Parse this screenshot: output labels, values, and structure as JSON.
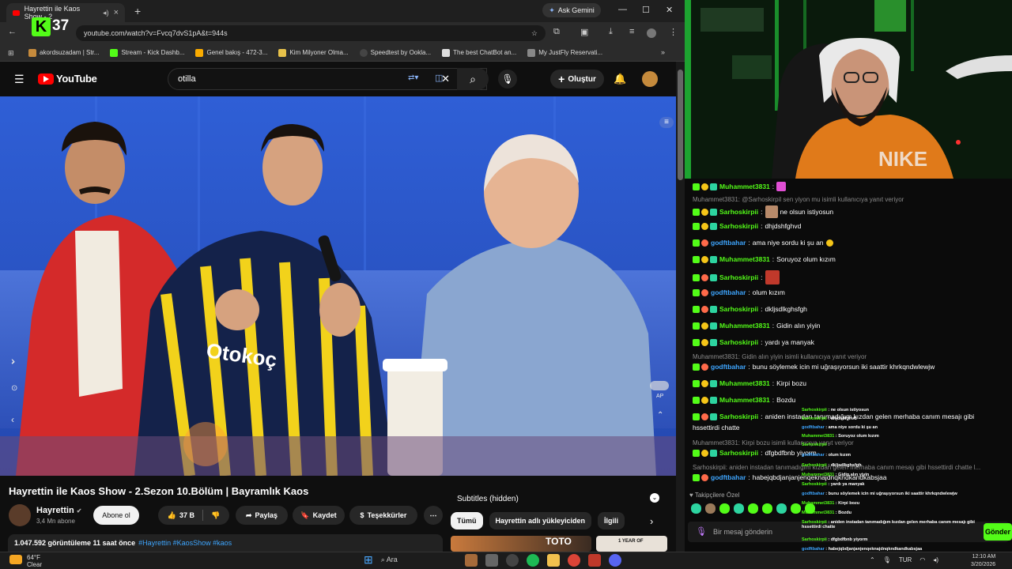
{
  "browser": {
    "tab_title": "Hayrettin ile Kaos Show - 2",
    "ask_gemini": "Ask Gemini",
    "url": "youtube.com/watch?v=Fvcq7dvS1pA&t=944s",
    "bookmarks": [
      "akordsuzadam | Str...",
      "Stream - Kick Dashb...",
      "Genel bakış - 472-3...",
      "Kim Milyoner Olma...",
      "Speedtest by Ookla...",
      "The best ChatBot an...",
      "My JustFly Reservati..."
    ],
    "colors": {
      "accent": "#53fc18",
      "youtube_red": "#ff0000",
      "link_blue": "#3ea6ff"
    }
  },
  "kick_overlay": {
    "logo": "K",
    "viewer_count": "37"
  },
  "youtube": {
    "logo_text": "YouTube",
    "search_value": "otilla",
    "create_label": "Oluştur",
    "video_title": "Hayrettin ile Kaos Show - 2.Sezon 10.Bölüm | Bayramlık Kaos",
    "channel_name": "Hayrettin",
    "subscribers": "3,4 Mn abone",
    "subscribe_label": "Abone ol",
    "likes": "37 B",
    "share_label": "Paylaş",
    "save_label": "Kaydet",
    "thanks_label": "Teşekkürler",
    "views_date": "1.047.592 görüntüleme  11 saat önce",
    "hashtags": "#Hayrettin #KaosShow #kaos",
    "subtitles": "Subtitles (hidden)",
    "chips": [
      "Tümü",
      "Hayrettin adlı yükleyiciden",
      "İlgili"
    ],
    "thumb_text": [
      "TOTO",
      "1 YEAR OF"
    ],
    "video_overlay_ap": "AP"
  },
  "taskbar": {
    "temp": "64°F",
    "weather": "Clear",
    "search": "Ara",
    "lang": "TUR",
    "time": "12:10 AM",
    "date": "3/20/2026"
  },
  "chat": {
    "messages": [
      {
        "user": "Muhammet3831",
        "text": "",
        "color": "#53fc18",
        "emote": true
      },
      {
        "reply": "Muhammet3831: @Sarhoskirpil sen yiyon mu isimli kullanıcıya yanıt veriyor"
      },
      {
        "user": "Sarhoskirpii",
        "text": "ne olsun istiyosun",
        "color": "#53fc18",
        "emote": true
      },
      {
        "user": "Sarhoskirpii",
        "text": "dhjdshfghvd",
        "color": "#53fc18"
      },
      {
        "user": "godftbahar",
        "text": "ama niye sordu ki şu an",
        "color": "#3ea6ff"
      },
      {
        "user": "Muhammet3831",
        "text": "Soruyoz olum kızım",
        "color": "#53fc18"
      },
      {
        "user": "Sarhoskirpii",
        "text": "",
        "color": "#53fc18",
        "emote": true
      },
      {
        "user": "godftbahar",
        "text": "olum kızım",
        "color": "#3ea6ff"
      },
      {
        "user": "Sarhoskirpii",
        "text": "dkljsdlkghsfgh",
        "color": "#53fc18"
      },
      {
        "user": "Muhammet3831",
        "text": "Gidin alın yiyin",
        "color": "#53fc18"
      },
      {
        "user": "Sarhoskirpii",
        "text": "yardı ya manyak",
        "color": "#53fc18"
      },
      {
        "reply": "Muhammet3831: Gidin alın yiyin isimli kullanıcıya yanıt veriyor"
      },
      {
        "user": "godftbahar",
        "text": "bunu söylemek icin mi uğraşıyorsun iki saattir khrkqndwlewjw",
        "color": "#3ea6ff"
      },
      {
        "user": "Muhammet3831",
        "text": "Kirpi bozu",
        "color": "#53fc18"
      },
      {
        "user": "Muhammet3831",
        "text": "Bozdu",
        "color": "#53fc18"
      },
      {
        "user": "Sarhoskirpii",
        "text": "aniden instadan tanımadığım kızdan gelen merhaba canım mesajı gibi",
        "color": "#53fc18"
      },
      {
        "cont": "hssettirdi chatte"
      },
      {
        "reply": "Muhammet3831: Kirpi bozu isimli kullanıcıya yanıt veriyor"
      },
      {
        "user": "Sarhoskirpii",
        "text": "dfgbdfbnb yiyorm",
        "color": "#53fc18"
      },
      {
        "reply": "Sarhoskirpii: aniden instadan tanımadığım kızdan gelen merhaba canım mesajı gibi hssettirdi chatte l..."
      },
      {
        "user": "godftbahar",
        "text": "habejqbdjanjanjenqeknajdnqkndkandkabsjaa",
        "color": "#3ea6ff"
      }
    ],
    "followers_only": "Takipçilere Özel",
    "input_placeholder": "Bir mesaj gönderin",
    "send_label": "Gönder"
  },
  "overlay_chat": [
    {
      "u": "Sarhoskirpii",
      "t": "ne olsun istiyosun"
    },
    {
      "u": "Sarhoskirpii",
      "t": "dhjdshfghvd"
    },
    {
      "u": "godftbahar",
      "t": "ama niye sordu ki şu an"
    },
    {
      "u": "Muhammet3831",
      "t": "Soruyoz olum kızım"
    },
    {
      "u": "Sarhoskirpii",
      "t": ""
    },
    {
      "u": "godftbahar",
      "t": "olum kızım"
    },
    {
      "u": "Sarhoskirpii",
      "t": "dkljsdlkghsfgh"
    },
    {
      "u": "Muhammet3831",
      "t": "Gidin alın yiyin"
    },
    {
      "u": "Sarhoskirpii",
      "t": "yardı ya manyak"
    },
    {
      "u": "godftbahar",
      "t": "bunu söylemek icin mi uğraşıyorsun iki saattir khrkqndwlewjw"
    },
    {
      "u": "Muhammet3831",
      "t": "Kirpi bozu"
    },
    {
      "u": "Muhammet3831",
      "t": "Bozdu"
    },
    {
      "u": "Sarhoskirpii",
      "t": "aniden instadan tanımadığım kızdan gelen merhaba canım mesajı gibi hssettirdi chatte"
    },
    {
      "u": "Sarhoskirpii",
      "t": "dfgbdfbnb yiyorm"
    },
    {
      "u": "godftbahar",
      "t": "habejqbdjanjanjenqeknajdnqkndkandkabsjaa"
    }
  ]
}
